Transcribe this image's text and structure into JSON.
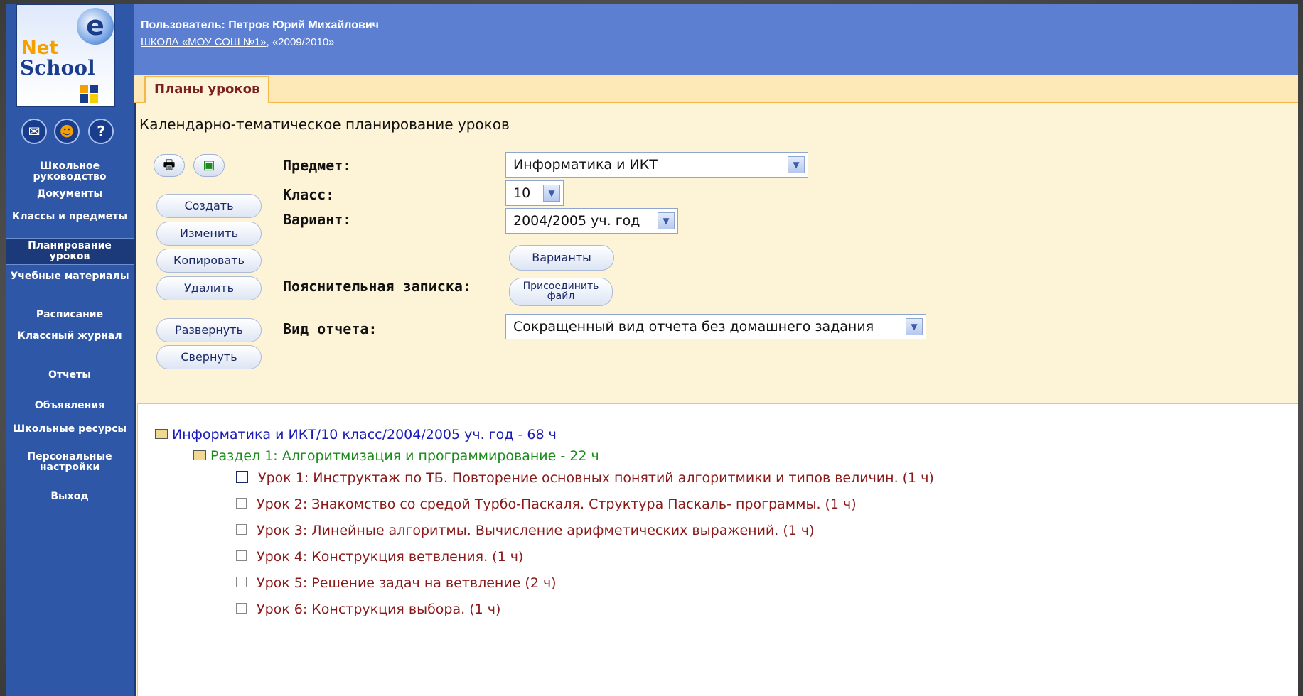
{
  "colors": {
    "sidebar": "#2f57a8",
    "header": "#5c7fd1",
    "content_bg": "#fdf3d6",
    "tab_text": "#7a1f1f",
    "level0": "#1a1ab8",
    "level1": "#1a8a1a",
    "level2": "#8a1a1a"
  },
  "logo": {
    "net": "Net",
    "school": "School"
  },
  "sidebar": {
    "top_icons": [
      {
        "name": "mail-icon",
        "glyph": "✉"
      },
      {
        "name": "users-icon",
        "glyph": "☻"
      },
      {
        "name": "help-icon",
        "glyph": "?"
      }
    ],
    "items": [
      {
        "label": "Школьное руководство"
      },
      {
        "label": "Документы"
      },
      {
        "label": "Классы и предметы"
      },
      {
        "label": "Планирование уроков",
        "active": true
      },
      {
        "label": "Учебные материалы"
      },
      {
        "label": "Расписание"
      },
      {
        "label": "Классный журнал"
      },
      {
        "label": "Отчеты"
      },
      {
        "label": "Объявления"
      },
      {
        "label": "Школьные ресурсы"
      },
      {
        "label": "Персональные настройки"
      },
      {
        "label": "Выход"
      }
    ]
  },
  "header": {
    "user": "Пользователь: Петров Юрий Михайлович",
    "school_link": "ШКОЛА «МОУ СОШ №1»",
    "year": ", «2009/2010»"
  },
  "tab": {
    "label": "Планы уроков"
  },
  "page": {
    "title": "Календарно-тематическое планирование уроков"
  },
  "toolbar": {
    "print_icon": "printer-icon",
    "excel_icon": "excel-icon"
  },
  "actions": {
    "create": "Создать",
    "edit": "Изменить",
    "copy": "Копировать",
    "delete": "Удалить",
    "expand": "Развернуть",
    "collapse": "Свернуть"
  },
  "form": {
    "subject_label": "Предмет:",
    "subject_value": "Информатика и ИКТ",
    "class_label": "Класс:",
    "class_value": "10",
    "variant_label": "Вариант:",
    "variant_value": "2004/2005 уч. год",
    "variants_button": "Варианты",
    "note_label": "Пояснительная записка:",
    "attach_line1": "Присоединить",
    "attach_line2": "файл",
    "report_label": "Вид отчета:",
    "report_value": "Сокращенный вид отчета без домашнего задания"
  },
  "tree": {
    "root": "Информатика и ИКТ/10 класс/2004/2005 уч. год - 68 ч",
    "section": "Раздел 1: Алгоритмизация и программирование - 22 ч",
    "lessons": [
      "Урок 1: Инструктаж по ТБ. Повторение основных понятий алгоритмики и типов величин. (1 ч)",
      "Урок 2: Знакомство со средой Турбо-Паскаля. Структура Паскаль- программы. (1 ч)",
      "Урок 3: Линейные алгоритмы. Вычисление арифметических выражений. (1 ч)",
      "Урок 4: Конструкция ветвления. (1 ч)",
      "Урок 5: Решение задач на ветвление (2 ч)",
      "Урок 6: Конструкция выбора. (1 ч)"
    ]
  }
}
